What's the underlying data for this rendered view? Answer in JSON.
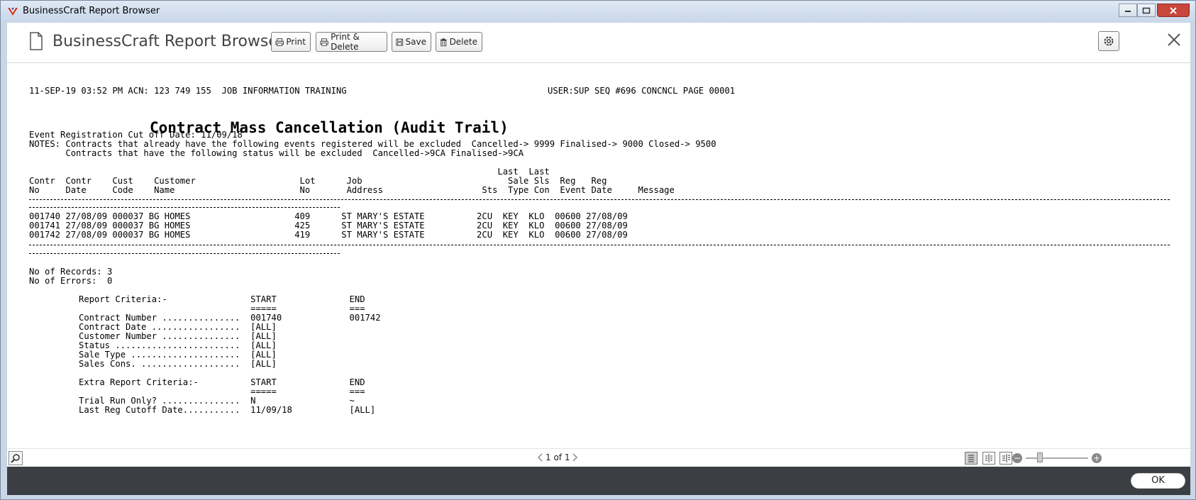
{
  "window": {
    "title": "BusinessCraft Report Browser"
  },
  "header": {
    "app_title": "BusinessCraft Report Browser",
    "buttons": {
      "print": "Print",
      "print_delete": "Print & Delete",
      "save": "Save",
      "delete": "Delete"
    }
  },
  "report": {
    "top_line_left": "11-SEP-19 03:52 PM ACN: 123 749 155  JOB INFORMATION TRAINING",
    "top_line_right": "USER:SUP SEQ #696 CONCNCL PAGE 00001",
    "title": "Contract Mass Cancellation (Audit Trail)",
    "cutoff_line": "Event Registration Cut off Date: 11/09/18",
    "notes_line1": "NOTES: Contracts that already have the following events registered will be excluded  Cancelled-> 9999 Finalised-> 9000 Closed-> 9500",
    "notes_line2": "       Contracts that have the following status will be excluded  Cancelled->9CA Finalised->9CA",
    "col_header_line1": "                                                                                          Last  Last",
    "col_header_line2": "Contr  Contr    Cust    Customer                    Lot      Job                            Sale Sls  Reg   Reg",
    "col_header_line3": "No     Date     Code    Name                        No       Address                   Sts  Type Con  Event Date     Message",
    "rows": [
      "001740 27/08/09 000037 BG HOMES                    409      ST MARY'S ESTATE          2CU  KEY  KLO  00600 27/08/09",
      "001741 27/08/09 000037 BG HOMES                    425      ST MARY'S ESTATE          2CU  KEY  KLO  00600 27/08/09",
      "001742 27/08/09 000037 BG HOMES                    419      ST MARY'S ESTATE          2CU  KEY  KLO  00600 27/08/09"
    ],
    "records_line": "No of Records: 3",
    "errors_line": "No of Errors:  0",
    "criteria_header": "Report Criteria:-                START              END",
    "criteria_underline": "                                 =====              ===",
    "criteria": [
      "Contract Number ...............  001740             001742",
      "Contract Date .................  [ALL]",
      "Customer Number ...............  [ALL]",
      "Status ........................  [ALL]",
      "Sale Type .....................  [ALL]",
      "Sales Cons. ...................  [ALL]"
    ],
    "extra_header": "Extra Report Criteria:-          START              END",
    "extra_underline": "                                 =====              ===",
    "extra": [
      "Trial Run Only? ...............  N                  ~",
      "Last Reg Cutoff Date...........  11/09/18           [ALL]"
    ]
  },
  "statusbar": {
    "page_text": "1 of 1"
  },
  "footer": {
    "ok_label": "OK"
  }
}
